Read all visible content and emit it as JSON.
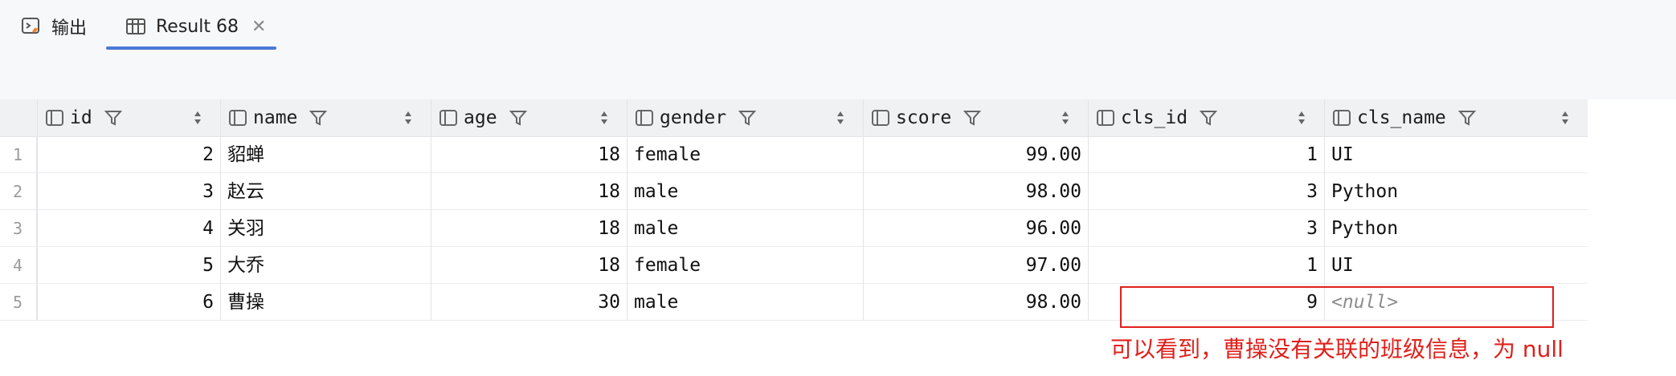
{
  "tabs": [
    {
      "label": "输出",
      "icon": "console-icon",
      "active": false
    },
    {
      "label": "Result 68",
      "icon": "table-icon",
      "active": true,
      "closable": true
    }
  ],
  "columns": [
    "id",
    "name",
    "age",
    "gender",
    "score",
    "cls_id",
    "cls_name"
  ],
  "rows": [
    {
      "n": "1",
      "cells": [
        "2",
        "貂蝉",
        "18",
        "female",
        "99.00",
        "1",
        "UI"
      ]
    },
    {
      "n": "2",
      "cells": [
        "3",
        "赵云",
        "18",
        "male",
        "98.00",
        "3",
        "Python"
      ]
    },
    {
      "n": "3",
      "cells": [
        "4",
        "关羽",
        "18",
        "male",
        "96.00",
        "3",
        "Python"
      ]
    },
    {
      "n": "4",
      "cells": [
        "5",
        "大乔",
        "18",
        "female",
        "97.00",
        "1",
        "UI"
      ]
    },
    {
      "n": "5",
      "cells": [
        "6",
        "曹操",
        "30",
        "male",
        "98.00",
        "9",
        "<null>"
      ]
    }
  ],
  "annotation": "可以看到，曹操没有关联的班级信息，为 null",
  "colors": {
    "accent": "#4a78d6",
    "annotation": "#e0201b"
  }
}
